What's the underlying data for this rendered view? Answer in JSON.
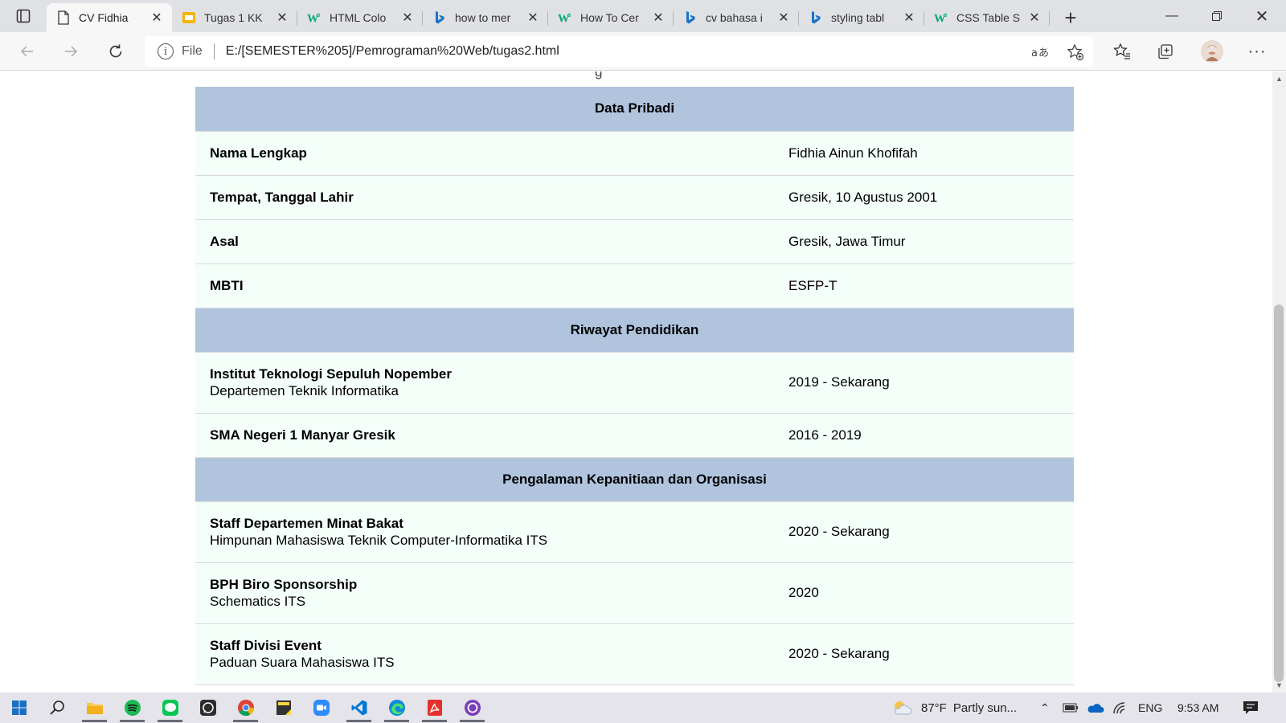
{
  "browser": {
    "tabs": [
      {
        "title": "CV Fidhia",
        "icon": "page-icon",
        "active": true
      },
      {
        "title": "Tugas 1 KK",
        "icon": "slides-icon",
        "active": false
      },
      {
        "title": "HTML Colo",
        "icon": "w3schools-icon",
        "active": false
      },
      {
        "title": "how to mer",
        "icon": "bing-icon",
        "active": false
      },
      {
        "title": "How To Cer",
        "icon": "w3schools-icon",
        "active": false
      },
      {
        "title": "cv bahasa i",
        "icon": "bing-icon",
        "active": false
      },
      {
        "title": "styling tabl",
        "icon": "bing-icon",
        "active": false
      },
      {
        "title": "CSS Table S",
        "icon": "w3schools-icon",
        "active": false
      }
    ],
    "address": {
      "scheme_label": "File",
      "url": "E:/[SEMESTER%205]/Pemrograman%20Web/tugas2.html"
    }
  },
  "page": {
    "cut_heading": "g",
    "sections": [
      {
        "title": "Data Pribadi",
        "rows": [
          {
            "label": "Nama Lengkap",
            "sub": "",
            "value": "Fidhia Ainun Khofifah"
          },
          {
            "label": "Tempat, Tanggal Lahir",
            "sub": "",
            "value": "Gresik, 10 Agustus 2001"
          },
          {
            "label": "Asal",
            "sub": "",
            "value": "Gresik, Jawa Timur"
          },
          {
            "label": "MBTI",
            "sub": "",
            "value": "ESFP-T"
          }
        ]
      },
      {
        "title": "Riwayat Pendidikan",
        "rows": [
          {
            "label": "Institut Teknologi Sepuluh Nopember",
            "sub": "Departemen Teknik Informatika",
            "value": "2019 - Sekarang"
          },
          {
            "label": "SMA Negeri 1 Manyar Gresik",
            "sub": "",
            "value": "2016 - 2019"
          }
        ]
      },
      {
        "title": "Pengalaman Kepanitiaan dan Organisasi",
        "rows": [
          {
            "label": "Staff Departemen Minat Bakat",
            "sub": "Himpunan Mahasiswa Teknik Computer-Informatika ITS",
            "value": "2020 - Sekarang"
          },
          {
            "label": "BPH Biro Sponsorship",
            "sub": "Schematics ITS",
            "value": "2020"
          },
          {
            "label": "Staff Divisi Event",
            "sub": "Paduan Suara Mahasiswa ITS",
            "value": "2020 - Sekarang"
          }
        ]
      }
    ]
  },
  "taskbar": {
    "apps": [
      "windows-start-icon",
      "search-icon",
      "file-explorer-icon",
      "spotify-icon",
      "line-icon",
      "whatsapp-icon",
      "chrome-icon",
      "sticky-notes-icon",
      "zoom-icon",
      "vscode-icon",
      "edge-icon",
      "acrobat-icon",
      "github-desktop-icon"
    ],
    "weather_temp": "87°F",
    "weather_text": "Partly sun...",
    "language": "ENG",
    "time": "9:53 AM"
  },
  "colors": {
    "section_header_bg": "#b0c4de",
    "row_bg": "#f5fffa",
    "tabstrip_bg": "#dfe1e5"
  }
}
